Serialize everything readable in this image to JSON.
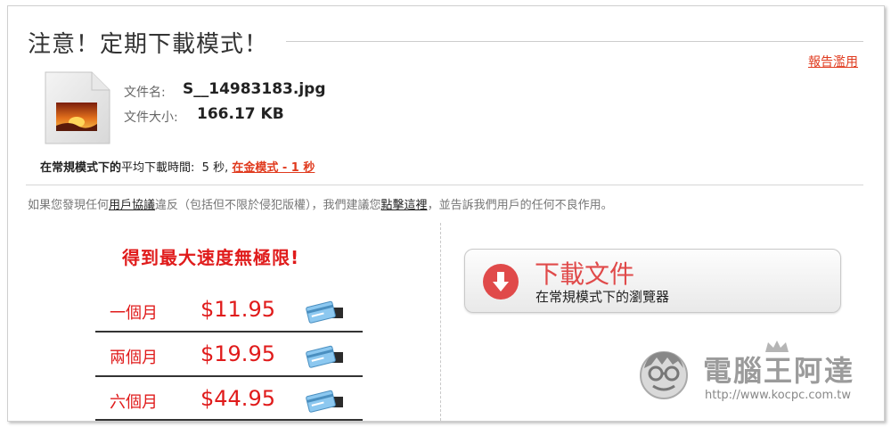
{
  "header": {
    "title": "注意！定期下載模式！",
    "report_link": "報告濫用"
  },
  "file": {
    "name_label": "文件名:",
    "name_value": "S__14983183.jpg",
    "size_label": "文件大小:",
    "size_value": "166.17 KB"
  },
  "avg_time": {
    "prefix_bold": "在常規模式下的",
    "prefix_normal": "平均下載時間:",
    "value": "5 秒,",
    "premium_link": "在金模式 - 1 秒"
  },
  "notice": {
    "part1": "如果您發現任何",
    "link1": "用戶協議",
    "part2": "違反（包括但不限於侵犯版權），我們建議您",
    "link2": "點擊這裡",
    "part3": "，並告訴我們用戶的任何不良作用。"
  },
  "promo": {
    "headline": "得到最大速度無極限!",
    "plans": [
      {
        "name": "一個月",
        "price": "$11.95"
      },
      {
        "name": "兩個月",
        "price": "$19.95"
      },
      {
        "name": "六個月",
        "price": "$44.95"
      }
    ]
  },
  "download": {
    "main_label": "下載文件",
    "sub_label": "在常規模式下的瀏覽器"
  },
  "watermark": {
    "brand": "電腦王阿達",
    "url": "http://www.kocpc.com.tw"
  },
  "icons": {
    "file": "image-file-icon",
    "card": "credit-card-icon",
    "download": "download-arrow-icon",
    "watermark": "mascot-logo-icon"
  },
  "colors": {
    "accent_red": "#e01b1b",
    "link_red": "#e03a1e",
    "button_red": "#e04a4a"
  }
}
